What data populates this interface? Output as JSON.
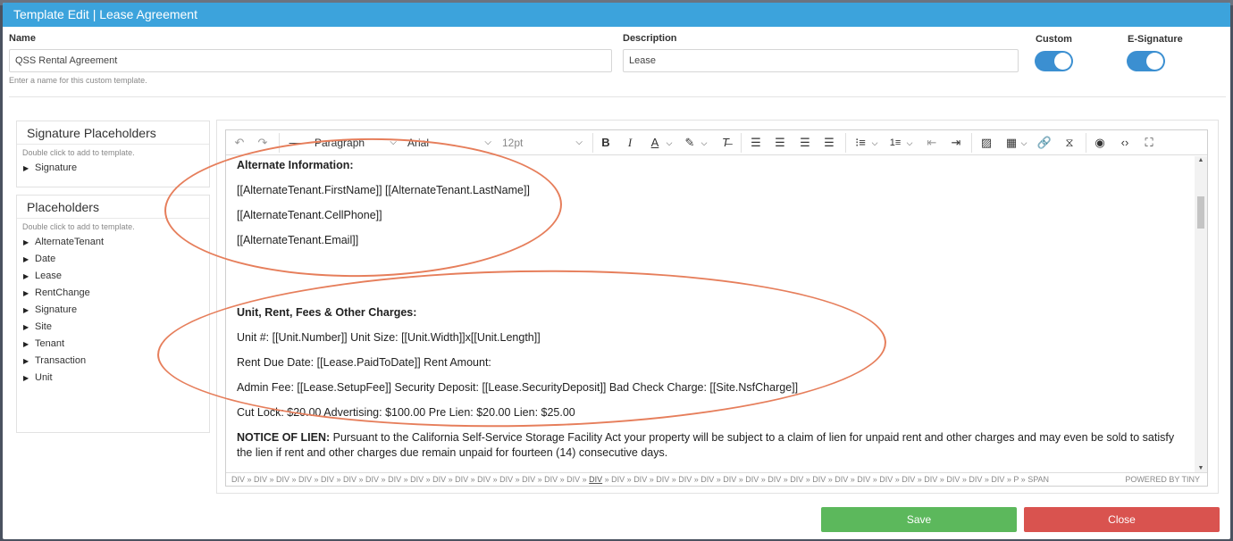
{
  "modal": {
    "title": "Template Edit | Lease Agreement"
  },
  "form": {
    "name_label": "Name",
    "name_value": "QSS Rental Agreement",
    "name_hint": "Enter a name for this custom template.",
    "description_label": "Description",
    "description_value": "Lease",
    "custom_label": "Custom",
    "custom_on": true,
    "esignature_label": "E-Signature",
    "esignature_on": true
  },
  "signature_panel": {
    "title": "Signature Placeholders",
    "hint": "Double click to add to template.",
    "items": [
      "Signature"
    ]
  },
  "placeholders_panel": {
    "title": "Placeholders",
    "hint": "Double click to add to template.",
    "items": [
      "AlternateTenant",
      "Date",
      "Lease",
      "RentChange",
      "Signature",
      "Site",
      "Tenant",
      "Transaction",
      "Unit"
    ]
  },
  "toolbar": {
    "block_format": "Paragraph",
    "font_family": "Arial",
    "font_size": "12pt",
    "icons": {
      "undo": "undo-icon",
      "redo": "redo-icon",
      "hr": "horizontal-line-icon",
      "bold": "bold-icon",
      "italic": "italic-icon",
      "text_color": "text-color-icon",
      "highlight": "highlight-icon",
      "clear_format": "clear-format-icon",
      "align_left": "align-left-icon",
      "align_center": "align-center-icon",
      "align_right": "align-right-icon",
      "justify": "justify-icon",
      "bullet_list": "bullet-list-icon",
      "numbered_list": "numbered-list-icon",
      "outdent": "outdent-icon",
      "indent": "indent-icon",
      "image": "image-icon",
      "table": "table-icon",
      "link": "link-icon",
      "page_break": "page-break-icon",
      "preview": "preview-icon",
      "source_code": "source-code-icon",
      "fullscreen": "fullscreen-icon"
    }
  },
  "document": {
    "alt_heading": "Alternate Information:",
    "alt_name": "[[AlternateTenant.FirstName]] [[AlternateTenant.LastName]]",
    "alt_phone": "[[AlternateTenant.CellPhone]]",
    "alt_email": "[[AlternateTenant.Email]]",
    "unit_heading": "Unit, Rent, Fees & Other Charges:",
    "unit_line": "Unit #: [[Unit.Number]] Unit Size: [[Unit.Width]]x[[Unit.Length]]",
    "rent_line": "Rent Due Date: [[Lease.PaidToDate]] Rent Amount:",
    "fee_line": "Admin Fee: [[Lease.SetupFee]] Security Deposit: [[Lease.SecurityDeposit]] Bad Check Charge: [[Site.NsfCharge]]",
    "cut_line": "Cut Lock: $20.00 Advertising: $100.00 Pre Lien: $20.00 Lien: $25.00",
    "notice_label": "NOTICE OF LIEN:",
    "notice_text": " Pursuant to the California Self-Service Storage Facility Act your property will be subject to a claim of lien for unpaid rent and other charges and may even be sold to satisfy the lien if rent and other charges  due remain unpaid for fourteen (14) consecutive days."
  },
  "status_bar": {
    "path_before": "DIV » DIV » DIV » DIV » DIV » DIV » DIV » DIV » DIV » DIV » DIV » DIV » DIV » DIV » DIV » DIV » ",
    "path_underlined": "DIV",
    "path_after": " » DIV » DIV » DIV » DIV » DIV » DIV » DIV » DIV » DIV » DIV » DIV » DIV » DIV » DIV » DIV » DIV » DIV » DIV » P » SPAN",
    "powered": "POWERED BY TINY"
  },
  "buttons": {
    "save": "Save",
    "close": "Close"
  },
  "colors": {
    "titlebar": "#3ca3dc",
    "toggle": "#3b8fd1",
    "save": "#5cb85c",
    "close": "#d9534f",
    "annotation": "#e67e5b"
  }
}
